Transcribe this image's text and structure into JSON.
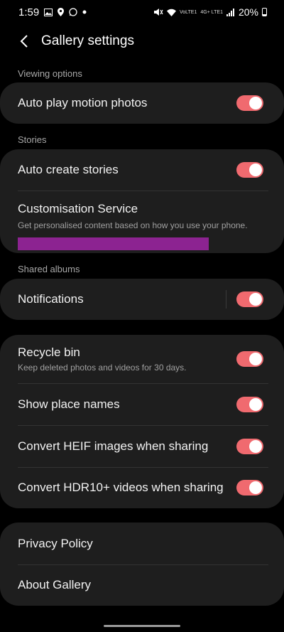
{
  "status_bar": {
    "time": "1:59",
    "volte": "VoLTE1",
    "lte": "4G+ LTE1",
    "battery": "20%"
  },
  "header": {
    "title": "Gallery settings"
  },
  "sections": {
    "viewing": "Viewing options",
    "stories": "Stories",
    "shared": "Shared albums"
  },
  "items": {
    "auto_play": {
      "title": "Auto play motion photos",
      "on": true
    },
    "auto_create": {
      "title": "Auto create stories",
      "on": true
    },
    "customisation": {
      "title": "Customisation Service",
      "subtitle": "Get personalised content based on how you use your phone."
    },
    "notifications": {
      "title": "Notifications",
      "on": true
    },
    "recycle_bin": {
      "title": "Recycle bin",
      "subtitle": "Keep deleted photos and videos for 30 days.",
      "on": true
    },
    "place_names": {
      "title": "Show place names",
      "on": true
    },
    "heif": {
      "title": "Convert HEIF images when sharing",
      "on": true
    },
    "hdr10": {
      "title": "Convert HDR10+ videos when sharing",
      "on": true
    },
    "privacy": {
      "title": "Privacy Policy"
    },
    "about": {
      "title": "About Gallery"
    }
  },
  "colors": {
    "accent": "#f06a6f",
    "card": "#1e1e1e",
    "redaction": "#8c2391"
  },
  "icons": [
    "image-icon",
    "location-icon",
    "whatsapp-icon",
    "mute-icon",
    "wifi-icon",
    "signal-icon",
    "battery-icon",
    "back-icon"
  ]
}
